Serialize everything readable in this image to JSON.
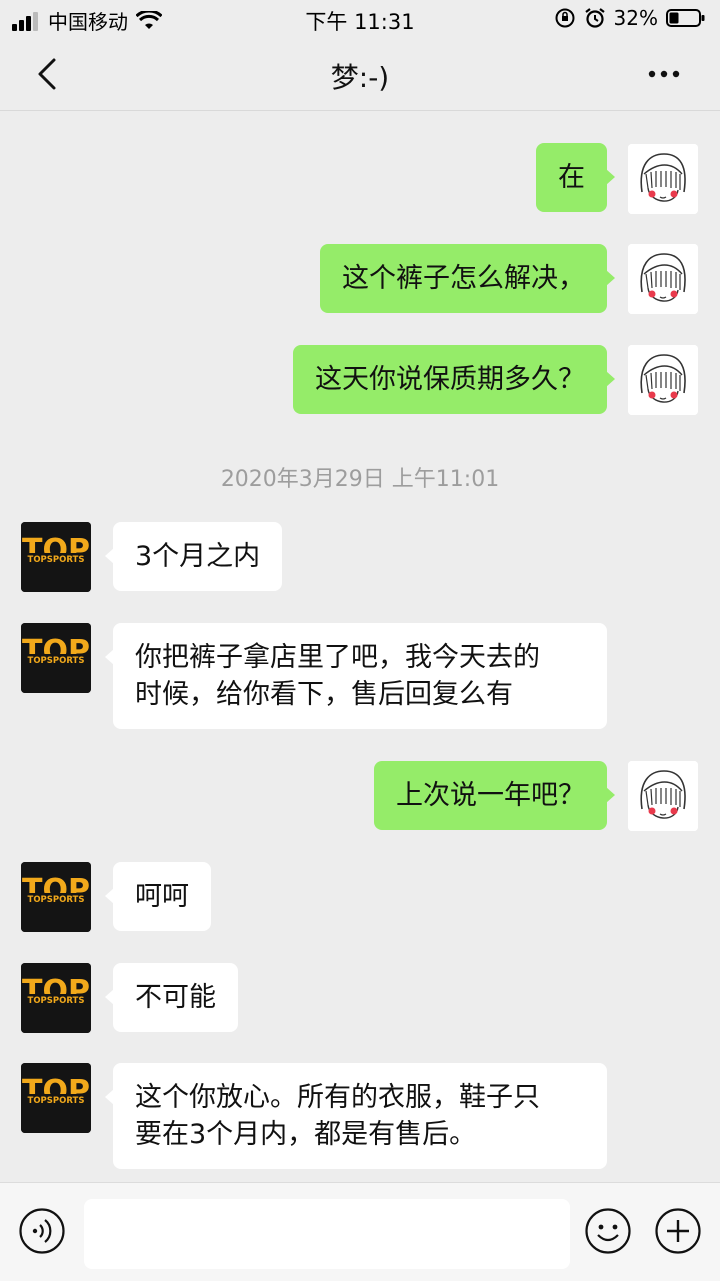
{
  "status": {
    "carrier": "中国移动",
    "time": "下午 11:31",
    "battery": "32%"
  },
  "header": {
    "title": "梦:-)"
  },
  "messages": [
    {
      "side": "right",
      "text": "在"
    },
    {
      "side": "right",
      "text": "这个裤子怎么解决，"
    },
    {
      "side": "right",
      "text": "这天你说保质期多久？"
    },
    {
      "side": "center",
      "text": "2020年3月29日 上午11:01"
    },
    {
      "side": "left",
      "text": "3个月之内"
    },
    {
      "side": "left",
      "text": "你把裤子拿店里了吧，我今天去的",
      "text2": "时候，给你看下，售后回复么有"
    },
    {
      "side": "right",
      "text": "上次说一年吧？"
    },
    {
      "side": "left",
      "text": "呵呵"
    },
    {
      "side": "left",
      "text": "不可能"
    },
    {
      "side": "left",
      "text": "这个你放心。所有的衣服，鞋子只",
      "text2": "要在3个月内，都是有售后。"
    }
  ],
  "logo": {
    "big_text": "TOP",
    "small_text": "TOPSPORTS",
    "color": "#f2a91b"
  },
  "colors": {
    "outgoing_bubble": "#95ec69",
    "incoming_bubble": "#ffffff",
    "background": "#ededed"
  },
  "input": {
    "value": "",
    "voice_icon": "voice-icon",
    "emoji_icon": "emoji-icon",
    "plus_icon": "plus-icon"
  }
}
